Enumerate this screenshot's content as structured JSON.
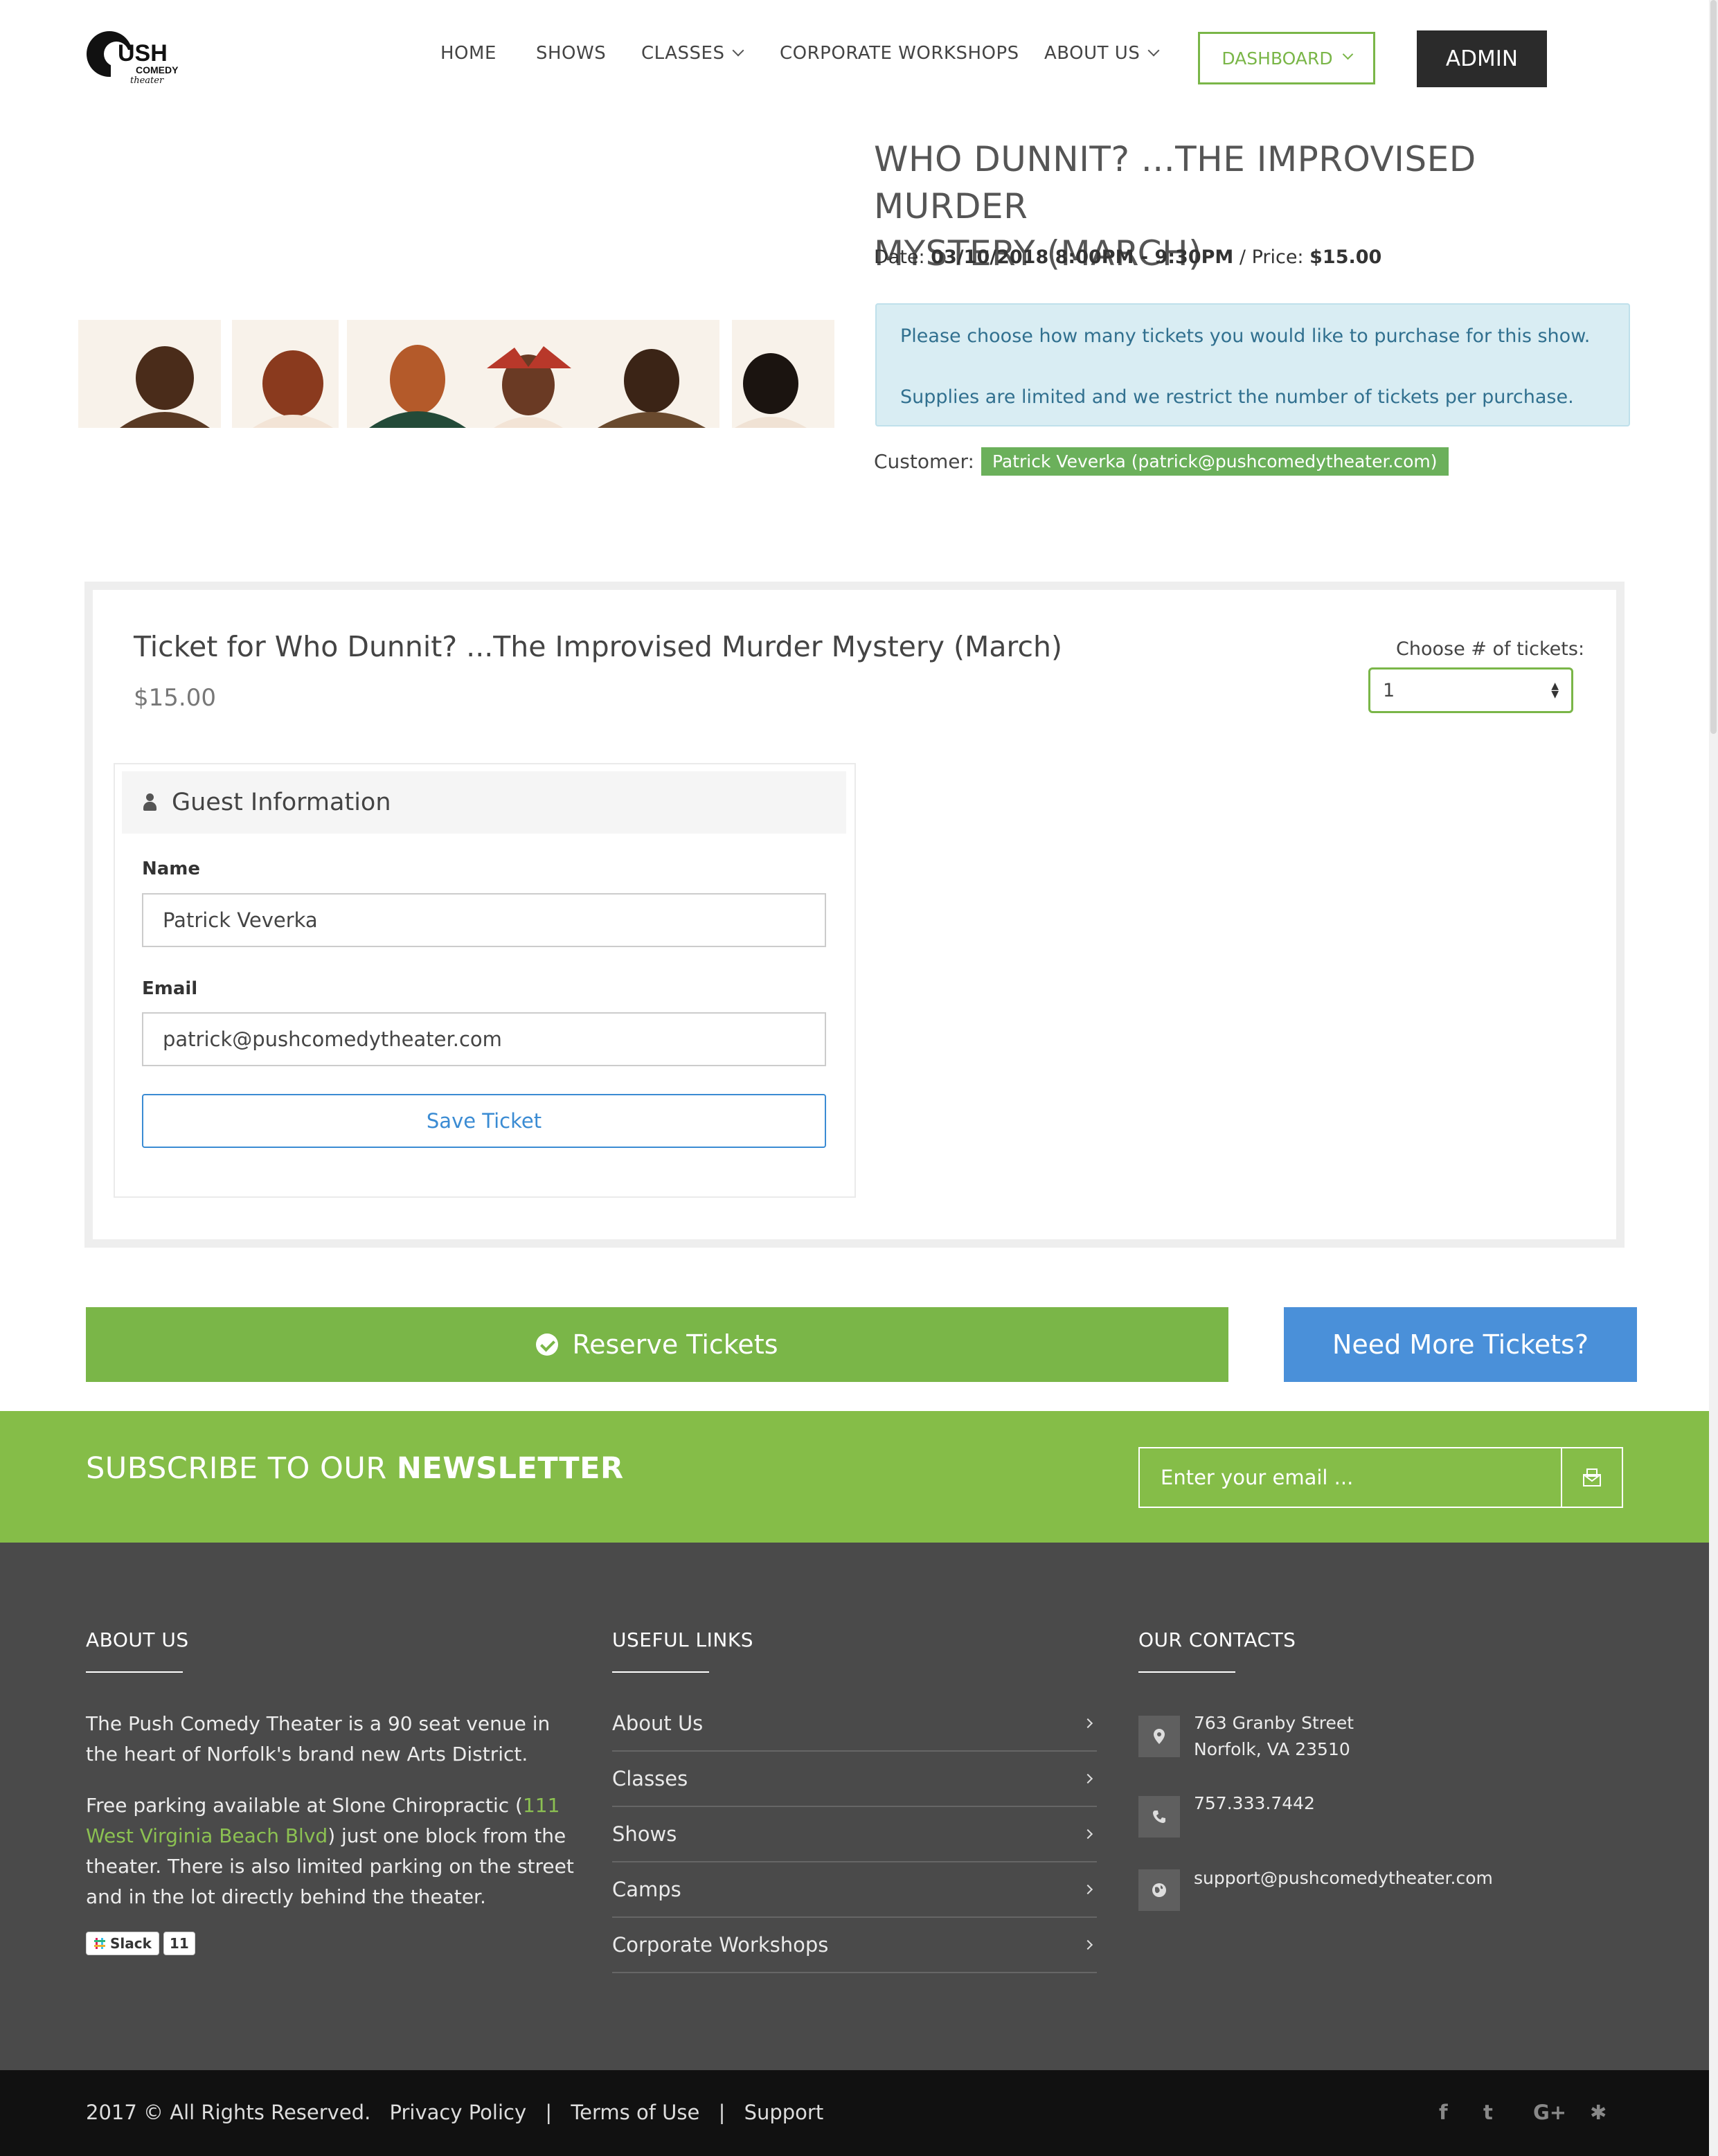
{
  "brand": {
    "logo_main": "USH",
    "logo_sub": "COMEDY",
    "logo_script": "theater"
  },
  "nav": {
    "home": "HOME",
    "shows": "SHOWS",
    "classes": "CLASSES",
    "corporate_workshops": "CORPORATE WORKSHOPS",
    "about_us": "ABOUT US",
    "dashboard": "DASHBOARD",
    "admin": "ADMIN"
  },
  "event": {
    "title_line1": "WHO DUNNIT? ...THE IMPROVISED MURDER",
    "title_line2": "MYSTERY (MARCH)",
    "date_label": "Date:",
    "date_value": "03/10/2018 8:00PM - 9:30PM",
    "price_sep": "/ Price:",
    "price_value": "$15.00",
    "info_line1": "Please choose how many tickets you would like to purchase for this show.",
    "info_line2": "Supplies are limited and we restrict the number of tickets per purchase.",
    "customer_label": "Customer:",
    "customer_value": "Patrick Veverka (patrick@pushcomedytheater.com)"
  },
  "ticket": {
    "title": "Ticket for Who Dunnit? ...The Improvised Murder Mystery (March)",
    "price": "$15.00",
    "choose_label": "Choose # of tickets:",
    "quantity": "1",
    "guest_header": "Guest Information",
    "name_label": "Name",
    "name_value": "Patrick Veverka",
    "email_label": "Email",
    "email_value": "patrick@pushcomedytheater.com",
    "save_label": "Save Ticket"
  },
  "actions": {
    "reserve_label": "Reserve Tickets",
    "more_label": "Need More Tickets?"
  },
  "newsletter": {
    "prefix": "SUBSCRIBE TO OUR",
    "bold": "NEWSLETTER",
    "placeholder": "Enter your email ..."
  },
  "footer": {
    "about": {
      "heading": "ABOUT US",
      "para1": "The Push Comedy Theater is a 90 seat venue in the heart of Norfolk's brand new Arts District.",
      "para2_pre": "Free parking available at Slone Chiropractic (",
      "para2_link": "111 West Virginia Beach Blvd",
      "para2_post": ") just one block from the theater. There is also limited parking on the street and in the lot directly behind the theater.",
      "slack_label": "Slack",
      "slack_count": "11"
    },
    "links": {
      "heading": "USEFUL LINKS",
      "items": [
        "About Us",
        "Classes",
        "Shows",
        "Camps",
        "Corporate Workshops"
      ]
    },
    "contacts": {
      "heading": "OUR CONTACTS",
      "address_line1": "763 Granby Street",
      "address_line2": "Norfolk, VA 23510",
      "phone": "757.333.7442",
      "email": "support@pushcomedytheater.com"
    }
  },
  "bottom": {
    "copyright": "2017 © All Rights Reserved.",
    "privacy": "Privacy Policy",
    "terms": "Terms of Use",
    "support": "Support",
    "separator": "|",
    "social": {
      "facebook": "f",
      "twitter": "t",
      "google_plus": "G+",
      "yelp": "✱"
    }
  },
  "colors": {
    "accent_green": "#7ab648",
    "newsletter_green": "#85bd48",
    "button_blue": "#4a90d9",
    "footer_dark": "#4a4a4a",
    "bottom_black": "#111111"
  }
}
